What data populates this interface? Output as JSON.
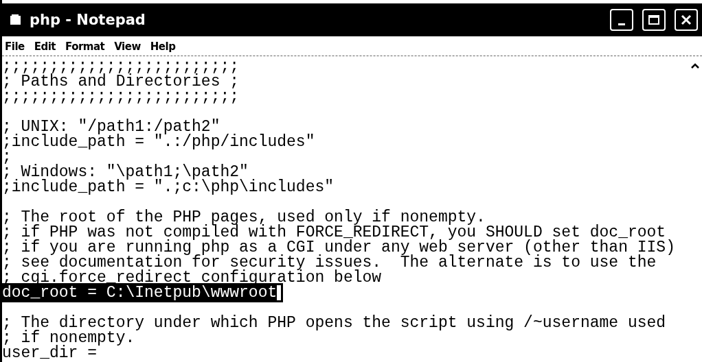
{
  "window": {
    "title": "php - Notepad"
  },
  "menu": [
    {
      "label": "File"
    },
    {
      "label": "Edit"
    },
    {
      "label": "Format"
    },
    {
      "label": "View"
    },
    {
      "label": "Help"
    }
  ],
  "editor": {
    "blocks": [
      {
        "lines": [
          {
            "text": ";;;;;;;;;;;;;;;;;;;;;;;;;",
            "selected": false
          },
          {
            "text": "; Paths and Directories ;",
            "selected": false
          },
          {
            "text": ";;;;;;;;;;;;;;;;;;;;;;;;;",
            "selected": false
          }
        ]
      },
      {
        "lines": [
          {
            "text": "; UNIX: \"/path1:/path2\"",
            "selected": false
          },
          {
            "text": ";include_path = \".:/php/includes\"",
            "selected": false
          },
          {
            "text": ";",
            "selected": false
          },
          {
            "text": "; Windows: \"\\path1;\\path2\"",
            "selected": false
          },
          {
            "text": ";include_path = \".;c:\\php\\includes\"",
            "selected": false
          }
        ]
      },
      {
        "lines": [
          {
            "text": "; The root of the PHP pages, used only if nonempty.",
            "selected": false
          },
          {
            "text": "; if PHP was not compiled with FORCE_REDIRECT, you SHOULD set doc_root",
            "selected": false
          },
          {
            "text": "; if you are running php as a CGI under any web server (other than IIS)",
            "selected": false
          },
          {
            "text": "; see documentation for security issues.  The alternate is to use the",
            "selected": false
          },
          {
            "text": "; cgi.force_redirect configuration below",
            "selected": false
          },
          {
            "text": "doc_root = C:\\Inetpub\\wwwroot",
            "selected": true
          }
        ]
      },
      {
        "lines": [
          {
            "text": "; The directory under which PHP opens the script using /~username used",
            "selected": false
          },
          {
            "text": "; if nonempty.",
            "selected": false
          },
          {
            "text": "user_dir =",
            "selected": false
          }
        ]
      }
    ]
  }
}
